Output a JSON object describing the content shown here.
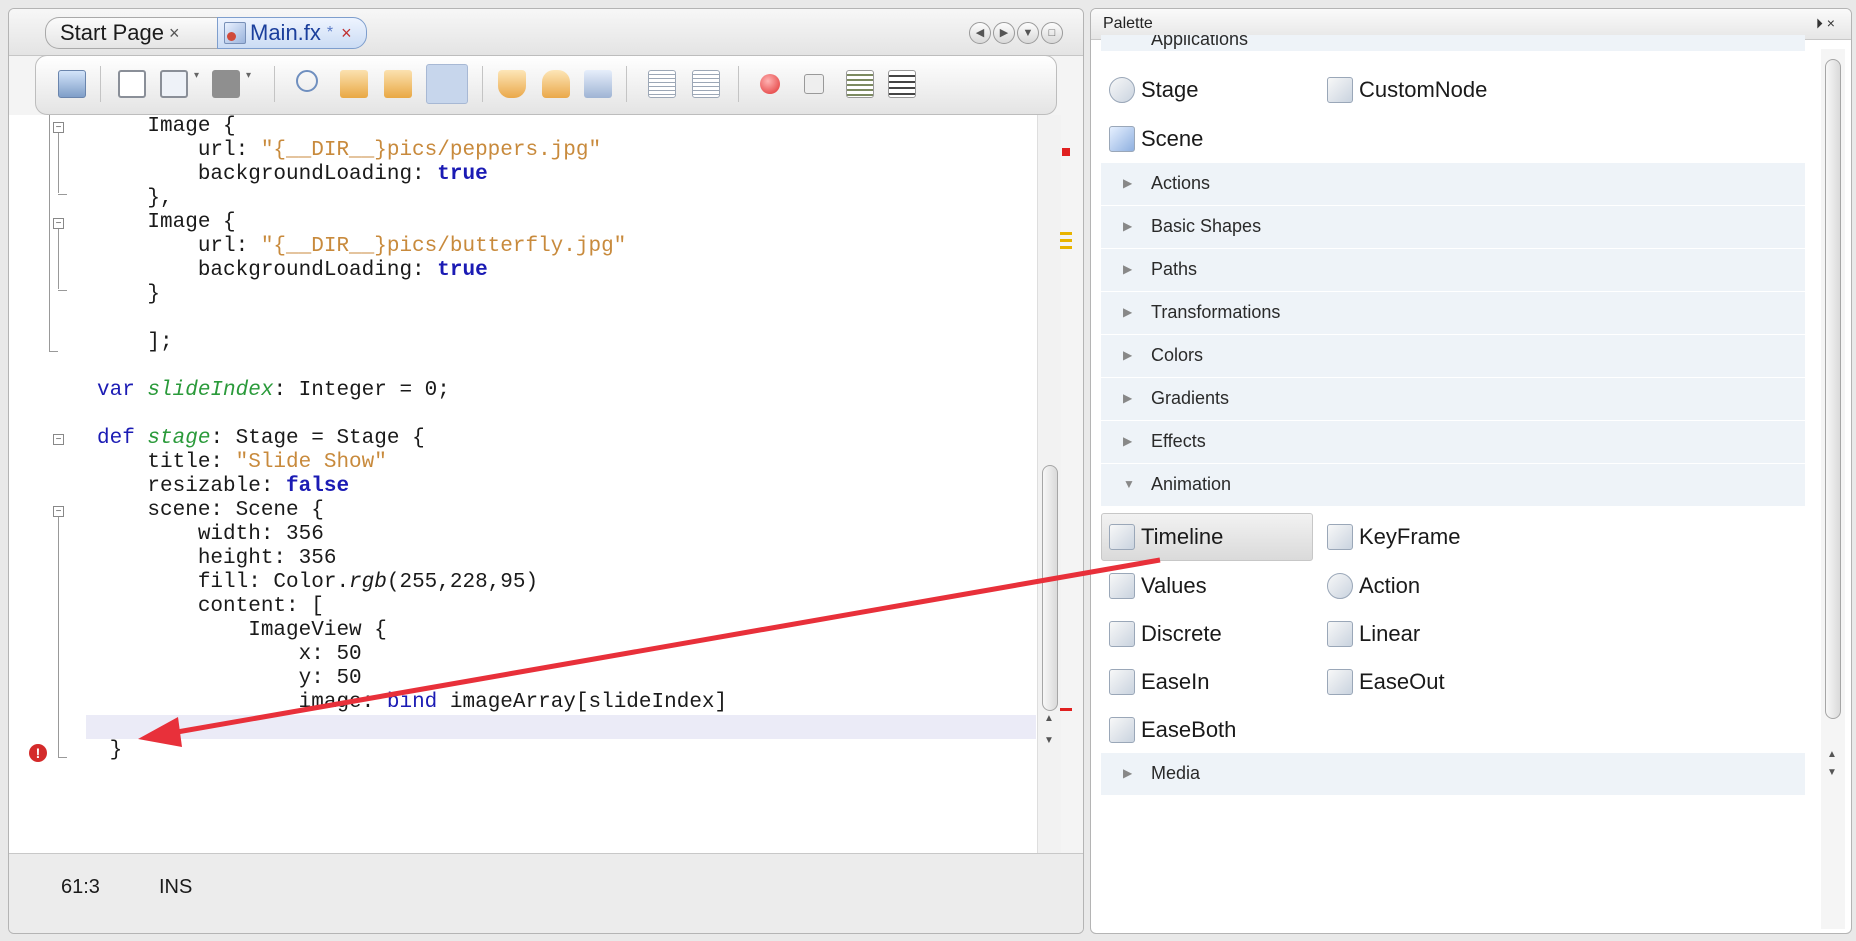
{
  "tabs": {
    "start_label": "Start Page",
    "start_close": "×",
    "main_label": "Main.fx",
    "main_modified": "*",
    "main_close": "×"
  },
  "tab_controls": [
    "◀",
    "▶",
    "▼",
    "□"
  ],
  "toolbar_icons": [
    "open-project",
    "back",
    "forward-dropdown",
    "stop-dropdown",
    "find",
    "find-previous",
    "find-next",
    "toggle-highlight",
    "previous-bookmark",
    "next-bookmark",
    "toggle-bookmark",
    "shift-left",
    "shift-right",
    "start-macro",
    "stop-macro",
    "comment",
    "uncomment"
  ],
  "code": {
    "lines": [
      [
        {
          "t": "    Image {"
        }
      ],
      [
        {
          "t": "        url: "
        },
        {
          "t": "\"{__DIR__}pics/peppers.jpg\"",
          "c": "str"
        }
      ],
      [
        {
          "t": "        backgroundLoading: "
        },
        {
          "t": "true",
          "c": "kw"
        }
      ],
      [
        {
          "t": "    },"
        }
      ],
      [
        {
          "t": "    Image {"
        }
      ],
      [
        {
          "t": "        url: "
        },
        {
          "t": "\"{__DIR__}pics/butterfly.jpg\"",
          "c": "str"
        }
      ],
      [
        {
          "t": "        backgroundLoading: "
        },
        {
          "t": "true",
          "c": "kw"
        }
      ],
      [
        {
          "t": "    }"
        }
      ],
      [
        {
          "t": ""
        }
      ],
      [
        {
          "t": "    ];"
        }
      ],
      [
        {
          "t": ""
        }
      ],
      [
        {
          "t": "var ",
          "c": "kw-plain"
        },
        {
          "t": "slideIndex",
          "c": "var"
        },
        {
          "t": ": Integer = 0;"
        }
      ],
      [
        {
          "t": ""
        }
      ],
      [
        {
          "t": "def ",
          "c": "kw-plain"
        },
        {
          "t": "stage",
          "c": "var"
        },
        {
          "t": ": Stage = Stage {"
        }
      ],
      [
        {
          "t": "    title: "
        },
        {
          "t": "\"Slide Show\"",
          "c": "str"
        }
      ],
      [
        {
          "t": "    resizable: "
        },
        {
          "t": "false",
          "c": "kw"
        }
      ],
      [
        {
          "t": "    scene: Scene {"
        }
      ],
      [
        {
          "t": "        width: 356"
        }
      ],
      [
        {
          "t": "        height: 356"
        }
      ],
      [
        {
          "t": "        fill: Color."
        },
        {
          "t": "rgb",
          "c": "it"
        },
        {
          "t": "(255,228,95)"
        }
      ],
      [
        {
          "t": "        content: ["
        }
      ],
      [
        {
          "t": "            ImageView {"
        }
      ],
      [
        {
          "t": "                x: 50"
        }
      ],
      [
        {
          "t": "                y: 50"
        }
      ],
      [
        {
          "t": "                image: "
        },
        {
          "t": "bind",
          "c": "kw-plain"
        },
        {
          "t": " imageArray[slideIndex]"
        }
      ],
      [
        {
          "t": ""
        }
      ],
      [
        {
          "t": " }"
        }
      ]
    ]
  },
  "status": {
    "position": "61:3",
    "mode": "INS"
  },
  "palette": {
    "title": "Palette",
    "controls": "⏵ ×",
    "partial_category": "Applications",
    "app_items": [
      {
        "label": "Stage",
        "icon": "stage-icon"
      },
      {
        "label": "CustomNode",
        "icon": "custom-node-icon"
      },
      {
        "label": "Scene",
        "icon": "scene-icon"
      }
    ],
    "categories": [
      {
        "label": "Actions",
        "expanded": false
      },
      {
        "label": "Basic Shapes",
        "expanded": false
      },
      {
        "label": "Paths",
        "expanded": false
      },
      {
        "label": "Transformations",
        "expanded": false
      },
      {
        "label": "Colors",
        "expanded": false
      },
      {
        "label": "Gradients",
        "expanded": false
      },
      {
        "label": "Effects",
        "expanded": false
      },
      {
        "label": "Animation",
        "expanded": true
      }
    ],
    "animation_items": [
      {
        "label": "Timeline",
        "icon": "timeline-icon"
      },
      {
        "label": "KeyFrame",
        "icon": "keyframe-icon"
      },
      {
        "label": "Values",
        "icon": "values-icon"
      },
      {
        "label": "Action",
        "icon": "action-icon"
      },
      {
        "label": "Discrete",
        "icon": "discrete-icon"
      },
      {
        "label": "Linear",
        "icon": "linear-icon"
      },
      {
        "label": "EaseIn",
        "icon": "easein-icon"
      },
      {
        "label": "EaseOut",
        "icon": "easeout-icon"
      },
      {
        "label": "EaseBoth",
        "icon": "easeboth-icon"
      }
    ],
    "bottom_category": {
      "label": "Media",
      "expanded": false
    }
  },
  "colors": {
    "arrow": "#e8303a",
    "keyword": "#1b1bb4",
    "string": "#c88a3c",
    "variable": "#2a9a3a"
  }
}
